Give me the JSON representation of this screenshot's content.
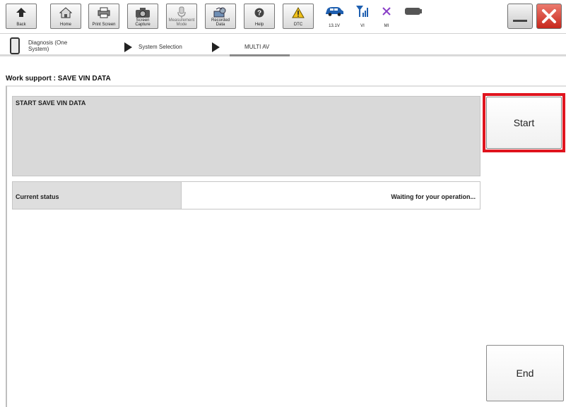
{
  "toolbar": {
    "buttons": [
      {
        "label": "Back",
        "icon": "back-arrow-icon"
      },
      {
        "label": "Home",
        "icon": "home-icon"
      },
      {
        "label": "Print Screen",
        "icon": "printer-icon"
      },
      {
        "label": "Screen Capture",
        "icon": "camera-icon"
      },
      {
        "label": "Measurement Mode",
        "icon": "measurement-icon"
      },
      {
        "label": "Recorded Data",
        "icon": "recorded-data-icon"
      },
      {
        "label": "Help",
        "icon": "help-icon"
      },
      {
        "label": "DTC",
        "icon": "warning-icon"
      }
    ],
    "status": {
      "battery_voltage": "13.1V",
      "vi_label": "VI",
      "mi_label": "MI"
    },
    "window": {
      "minimize": "minimize",
      "close": "close"
    }
  },
  "breadcrumb": {
    "items": [
      "Diagnosis (One System)",
      "System Selection",
      "MULTI AV"
    ]
  },
  "page": {
    "title": "Work support : SAVE VIN DATA",
    "panel_label": "START SAVE VIN DATA",
    "status_label": "Current status",
    "status_value": "Waiting for your operation..."
  },
  "buttons": {
    "start": "Start",
    "end": "End"
  },
  "colors": {
    "highlight": "#e0141e",
    "close_button": "#d9342b",
    "status_blue": "#1e5fb0"
  }
}
